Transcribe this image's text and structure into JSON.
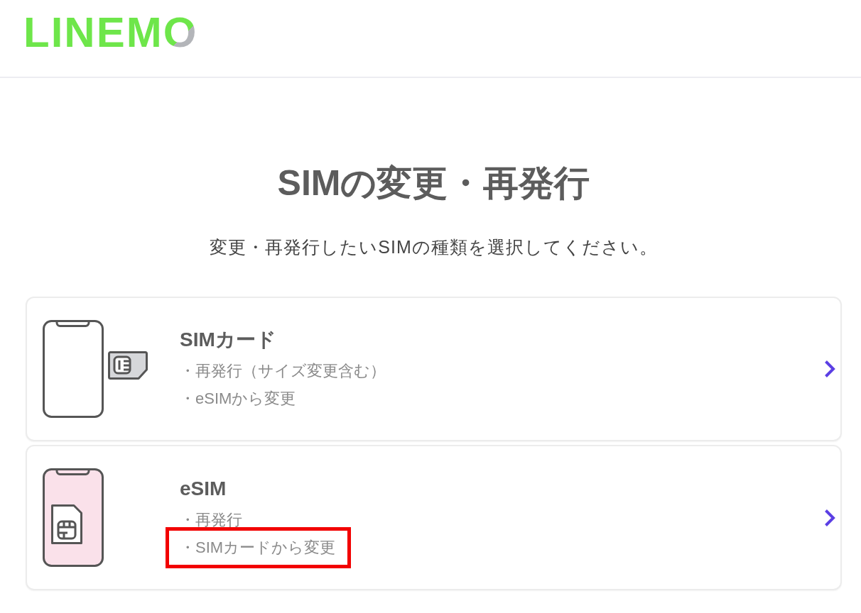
{
  "header": {
    "logo": "LINEMO"
  },
  "page": {
    "title": "SIMの変更・再発行",
    "subtitle": "変更・再発行したいSIMの種類を選択してください。"
  },
  "options": [
    {
      "kind": "sim-card",
      "title": "SIMカード",
      "items": [
        {
          "text": "・再発行（サイズ変更含む）",
          "highlighted": false
        },
        {
          "text": "・eSIMから変更",
          "highlighted": false
        }
      ]
    },
    {
      "kind": "esim",
      "title": "eSIM",
      "items": [
        {
          "text": "・再発行",
          "highlighted": false
        },
        {
          "text": "・SIMカードから変更",
          "highlighted": true
        }
      ]
    }
  ]
}
